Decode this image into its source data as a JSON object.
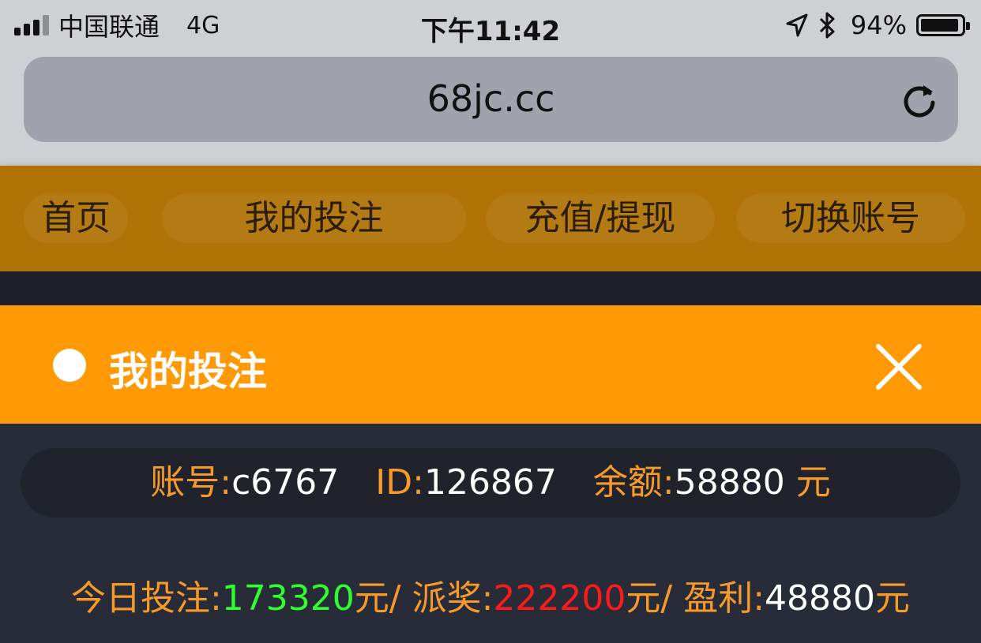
{
  "status_bar": {
    "carrier": "中国联通",
    "network": "4G",
    "time": "下午11:42",
    "battery_percent": "94%",
    "battery_level": 0.94,
    "icons": [
      "signal-icon",
      "location-arrow-icon",
      "bluetooth-icon",
      "battery-icon"
    ]
  },
  "browser": {
    "url": "68jc.cc",
    "reload_icon": "reload-icon"
  },
  "nav": {
    "items": [
      {
        "label": "首页"
      },
      {
        "label": "我的投注"
      },
      {
        "label": "充值/提现"
      },
      {
        "label": "切换账号"
      }
    ]
  },
  "dialog": {
    "title": "我的投注",
    "close_icon": "close-icon"
  },
  "account": {
    "account_label": "账号:",
    "account_value": "c6767",
    "id_label": "ID:",
    "id_value": "126867",
    "balance_label": "余额:",
    "balance_value": "58880",
    "balance_unit": "元"
  },
  "stats": {
    "bet_label": "今日投注:",
    "bet_value": "173320",
    "bet_suffix": "元/",
    "payout_label": "派奖:",
    "payout_value": "222200",
    "payout_suffix": "元/",
    "profit_label": "盈利:",
    "profit_value": "48880",
    "profit_suffix": "元"
  },
  "colors": {
    "nav_bg": "#b07308",
    "dialog_header": "#ff9a06",
    "label_orange": "#f79a29",
    "bet_green": "#2eff2e",
    "payout_red": "#ff1a1a",
    "panel_bg": "#282c38"
  }
}
